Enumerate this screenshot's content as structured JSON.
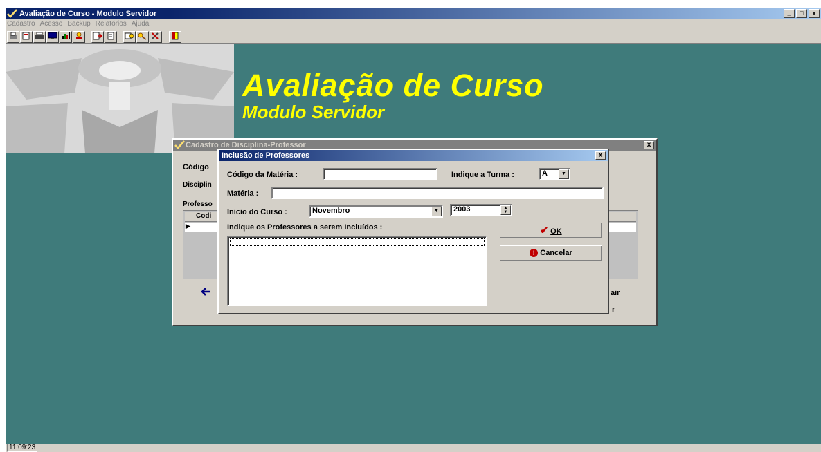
{
  "app": {
    "title": "Avaliação de Curso - Modulo Servidor",
    "menu": [
      "Cadastro",
      "Acesso",
      "Backup",
      "Relatórios",
      "Ajuda"
    ],
    "window_buttons": [
      "_",
      "□",
      "x"
    ],
    "hero_title": "Avaliação de Curso",
    "hero_subtitle": "Modulo Servidor",
    "clock": "11:09:23",
    "colors": {
      "desktop": "#3f7b7b",
      "title_accent": "#ffff00",
      "titlebar": "#0a246a"
    }
  },
  "toolbar": {
    "icons": [
      "printer-icon",
      "report-icon",
      "print-preview-icon",
      "monitor-icon",
      "chart-icon",
      "users-icon",
      "import-icon",
      "document-icon",
      "stats-icon",
      "key-icon",
      "tools-icon",
      "exit-door-icon"
    ]
  },
  "dialog_disciplina": {
    "title": "Cadastro de Disciplina-Professor",
    "close": "x",
    "codigo_label": "Código",
    "disciplina_label": "Disciplin",
    "professores_label": "Professo",
    "grid_col_label": "Codi",
    "row_marker": "▶",
    "sair_label": "air",
    "r_label": "r"
  },
  "dialog_inclusao": {
    "title": "Inclusão de Professores",
    "close": "x",
    "codigo_materia_label": "Código da Matéria :",
    "codigo_materia_value": "",
    "turma_label": "Indique a Turma :",
    "turma_value": "A",
    "materia_label": "Matéria :",
    "materia_value": "",
    "inicio_label": "Inicio do Curso :",
    "mes_value": "Novembro",
    "ano_value": "2003",
    "professores_label": "Indique os Professores a serem Incluídos :",
    "ok_label": "OK",
    "cancelar_label": "Cancelar"
  }
}
